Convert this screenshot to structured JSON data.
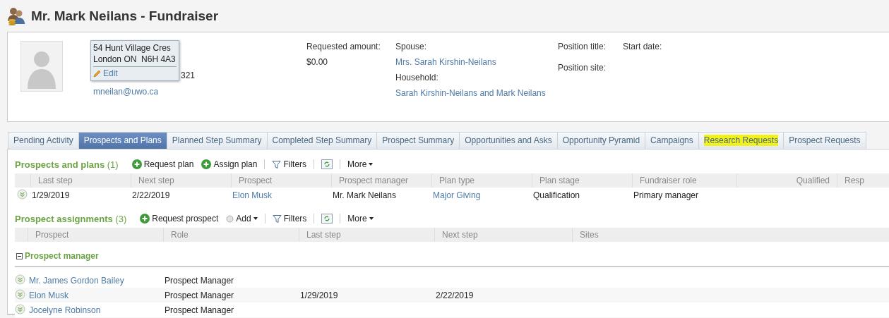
{
  "title": "Mr. Mark Neilans - Fundraiser",
  "contact": {
    "address_lines": [
      "54 Hunt Village Cres",
      "London ON  N6H 4A3"
    ],
    "edit_label": "Edit",
    "phone": "321",
    "email": "mneilan@uwo.ca"
  },
  "summary_columns": [
    [
      {
        "label": "Requested amount:",
        "value": "$0.00",
        "link": false
      }
    ],
    [
      {
        "label": "Spouse:",
        "value": "Mrs. Sarah Kirshin-Neilans",
        "link": true
      },
      {
        "label": "Household:",
        "value": "Sarah Kirshin-Neilans and Mark Neilans",
        "link": true
      }
    ],
    [
      {
        "label": "Position title:"
      },
      {
        "label": "Position site:"
      }
    ],
    [
      {
        "label": "Start date:"
      }
    ]
  ],
  "tabs": [
    {
      "label": "Pending Activity",
      "selected": false,
      "highlighted": false
    },
    {
      "label": "Prospects and Plans",
      "selected": true,
      "highlighted": false
    },
    {
      "label": "Planned Step Summary",
      "selected": false,
      "highlighted": false
    },
    {
      "label": "Completed Step Summary",
      "selected": false,
      "highlighted": false
    },
    {
      "label": "Prospect Summary",
      "selected": false,
      "highlighted": false
    },
    {
      "label": "Opportunities and Asks",
      "selected": false,
      "highlighted": false
    },
    {
      "label": "Opportunity Pyramid",
      "selected": false,
      "highlighted": false
    },
    {
      "label": "Campaigns",
      "selected": false,
      "highlighted": false
    },
    {
      "label": "Research Requests",
      "selected": false,
      "highlighted": true
    },
    {
      "label": "Prospect Requests",
      "selected": false,
      "highlighted": false
    }
  ],
  "sections": [
    {
      "title": "Prospects and plans",
      "count": "(1)",
      "actions": [
        {
          "kind": "add",
          "label": "Request plan"
        },
        {
          "kind": "add",
          "label": "Assign plan"
        },
        {
          "kind": "filter",
          "label": "Filters"
        },
        {
          "kind": "refresh"
        },
        {
          "kind": "more",
          "label": "More"
        }
      ],
      "columns": [
        {
          "label": "Last step",
          "right_aligned": false
        },
        {
          "label": "Next step",
          "right_aligned": false
        },
        {
          "label": "Prospect",
          "right_aligned": false
        },
        {
          "label": "Prospect manager",
          "right_aligned": false
        },
        {
          "label": "Plan type",
          "right_aligned": false
        },
        {
          "label": "Plan stage",
          "right_aligned": false
        },
        {
          "label": "Fundraiser role",
          "right_aligned": false
        },
        {
          "label": "Qualified",
          "right_aligned": true
        },
        {
          "label": "Resp"
        }
      ],
      "rows": [
        {
          "cells": [
            {
              "text": "1/29/2019",
              "link": false
            },
            {
              "text": "2/22/2019",
              "link": false
            },
            {
              "text": "Elon Musk",
              "link": true
            },
            {
              "text": "Mr. Mark Neilans",
              "link": false
            },
            {
              "text": "Major Giving",
              "link": true
            },
            {
              "text": "Qualification",
              "link": false
            },
            {
              "text": "Primary manager",
              "link": false
            }
          ]
        }
      ]
    },
    {
      "title": "Prospect assignments",
      "count": "(3)",
      "actions": [
        {
          "kind": "add",
          "label": "Request prospect"
        },
        {
          "kind": "menu",
          "label": "Add"
        },
        {
          "kind": "filter",
          "label": "Filters"
        },
        {
          "kind": "refresh"
        },
        {
          "kind": "more",
          "label": "More"
        }
      ],
      "columns": [
        {
          "label": "Prospect",
          "right_aligned": false
        },
        {
          "label": "Role",
          "right_aligned": false
        },
        {
          "label": "Last step",
          "right_aligned": false
        },
        {
          "label": "Next step",
          "right_aligned": false
        },
        {
          "label": "Sites",
          "right_aligned": false
        }
      ],
      "groups": [
        {
          "label": "Prospect manager",
          "expanded": true,
          "rows": [
            {
              "cells": [
                {
                  "text": "Mr. James Gordon Bailey",
                  "link": true
                },
                {
                  "text": "Prospect Manager",
                  "link": false
                }
              ]
            },
            {
              "cells": [
                {
                  "text": "Elon Musk",
                  "link": true
                },
                {
                  "text": "Prospect Manager",
                  "link": false
                },
                {
                  "text": "1/29/2019",
                  "link": false
                },
                {
                  "text": "2/22/2019",
                  "link": false
                }
              ]
            },
            {
              "cells": [
                {
                  "text": "Jocelyne Robinson",
                  "link": true
                },
                {
                  "text": "Prospect Manager",
                  "link": false
                }
              ]
            }
          ]
        }
      ]
    }
  ]
}
